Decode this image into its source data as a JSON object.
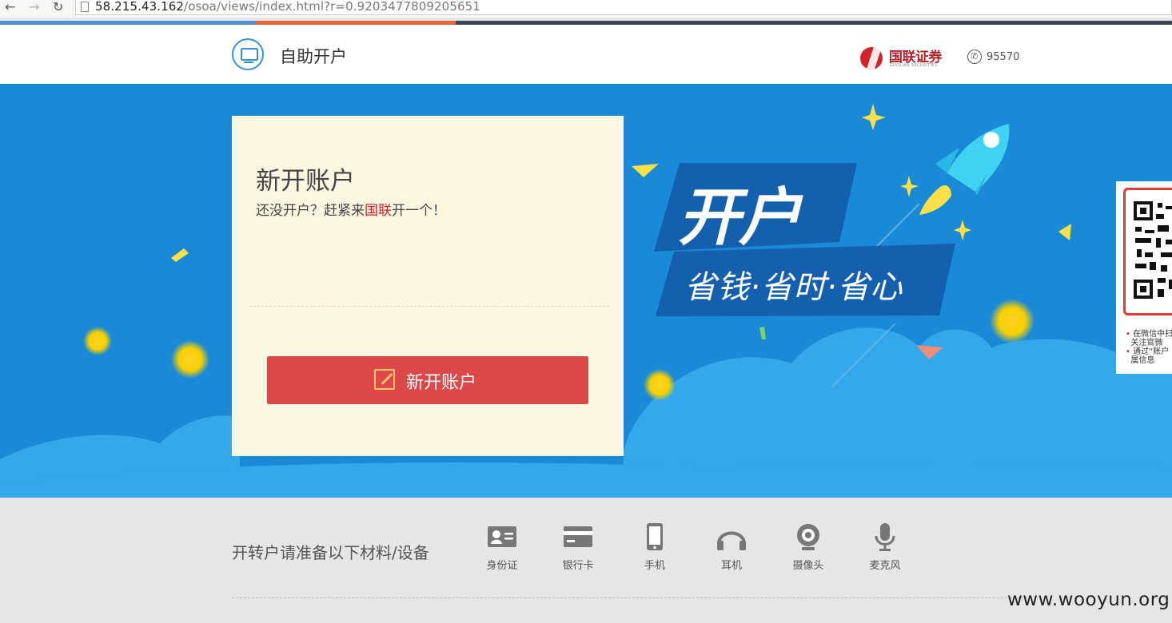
{
  "browser": {
    "url_host": "58.215.43.162",
    "url_path": "/osoa/views/index.html?r=0.9203477809205651",
    "back_icon": "back-arrow-icon",
    "forward_icon": "forward-arrow-icon",
    "reload_icon": "reload-icon"
  },
  "header": {
    "title": "自助开户",
    "brand_name": "国联证券",
    "brand_sub": "GUOLIAN SECURITIES",
    "phone": "95570",
    "icon": "monitor-icon"
  },
  "card": {
    "title": "新开账户",
    "subtitle_before": "还没开户？赶紧来",
    "subtitle_highlight": "国联",
    "subtitle_after": "开一个！",
    "button_label": "新开账户",
    "highlight_color": "#c7262c",
    "button_color": "#dd4848"
  },
  "promo": {
    "main": "开户",
    "tagline": "省钱·省时·省心"
  },
  "qr": {
    "note_line1": "在微信中扫",
    "note_line2": "关注官微",
    "note_line3": "通过“账户",
    "note_line4": "属信息"
  },
  "materials": {
    "label": "开转户请准备以下材料/设备",
    "items": [
      {
        "label": "身份证",
        "icon": "id-card-icon"
      },
      {
        "label": "银行卡",
        "icon": "bank-card-icon"
      },
      {
        "label": "手机",
        "icon": "mobile-phone-icon"
      },
      {
        "label": "耳机",
        "icon": "headphones-icon"
      },
      {
        "label": "摄像头",
        "icon": "webcam-icon"
      },
      {
        "label": "麦克风",
        "icon": "microphone-icon"
      }
    ]
  },
  "watermark": "www.wooyun.org",
  "colors": {
    "banner_blue": "#1a8ad6",
    "cloud_blue": "#33a8ea",
    "card_bg": "#fdf6e0",
    "brand_red": "#d2232a"
  }
}
